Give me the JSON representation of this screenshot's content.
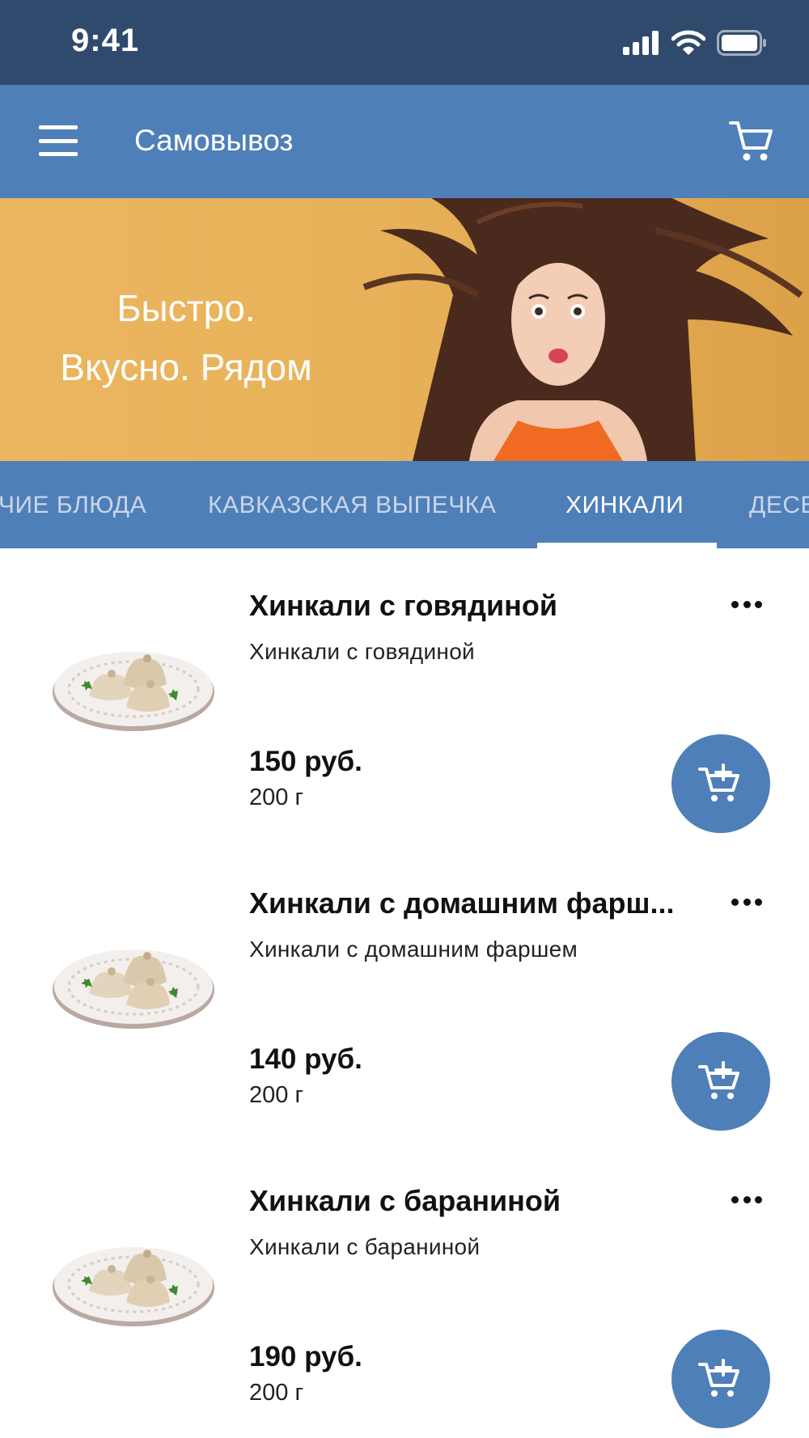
{
  "status_bar": {
    "time": "9:41"
  },
  "app_bar": {
    "title": "Самовывоз",
    "menu_icon": "hamburger-icon",
    "cart_icon": "cart-icon"
  },
  "banner": {
    "line1": "Быстро.",
    "line2": "Вкусно. Рядом"
  },
  "tabs": [
    {
      "label": "ЧИЕ БЛЮДА",
      "active": false
    },
    {
      "label": "КАВКАЗСКАЯ ВЫПЕЧКА",
      "active": false
    },
    {
      "label": "ХИНКАЛИ",
      "active": true
    },
    {
      "label": "ДЕСЕ",
      "active": false
    }
  ],
  "items": [
    {
      "title": "Хинкали с говядиной",
      "description": "Хинкали с говядиной",
      "price": "150 руб.",
      "weight": "200 г"
    },
    {
      "title": "Хинкали с домашним фарш...",
      "description": "Хинкали с домашним фаршем",
      "price": "140 руб.",
      "weight": "200 г"
    },
    {
      "title": "Хинкали с бараниной",
      "description": "Хинкали с бараниной",
      "price": "190 руб.",
      "weight": "200 г"
    }
  ],
  "colors": {
    "status_bar": "#2f4a6d",
    "primary": "#4f7fb8",
    "banner": "#e8b25a"
  }
}
